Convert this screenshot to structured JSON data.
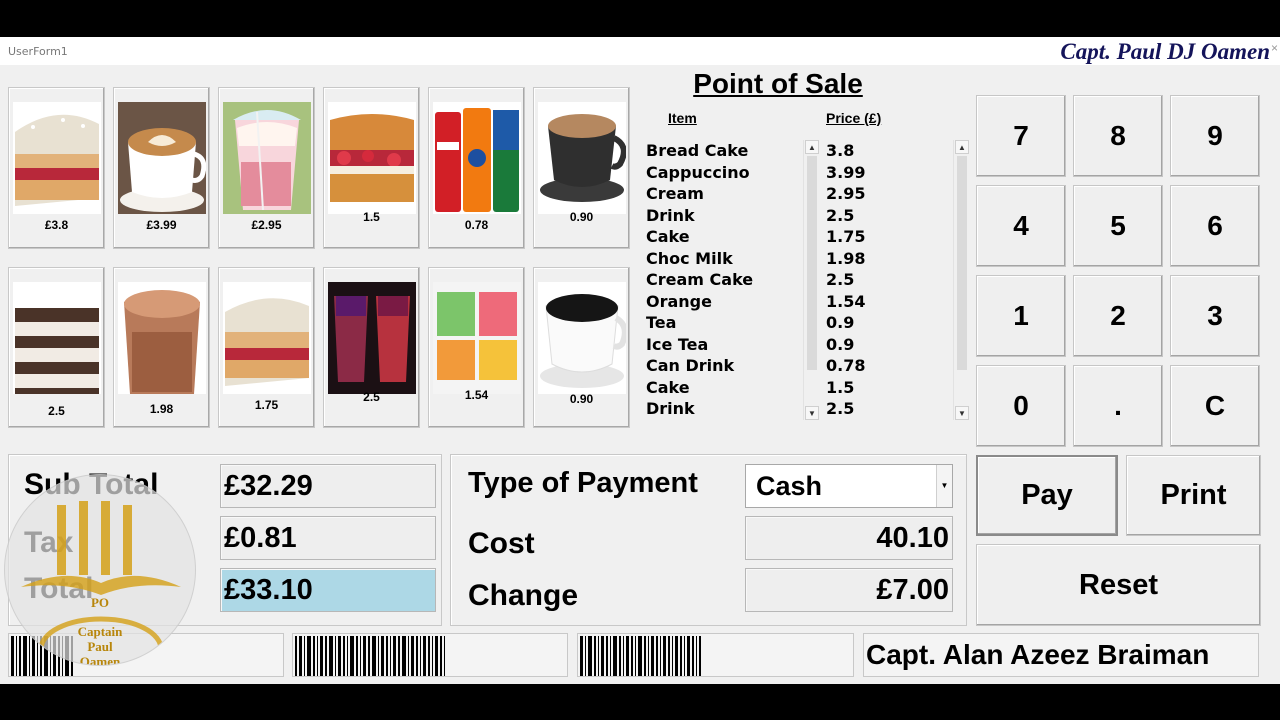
{
  "window": {
    "title": "UserForm1",
    "author": "Capt. Paul DJ Oamen",
    "close_icon": "×"
  },
  "tiles": [
    {
      "name": "bread-cake-tile",
      "price": "£3.8"
    },
    {
      "name": "cappuccino-tile",
      "price": "£3.99"
    },
    {
      "name": "cream-tile",
      "price": "£2.95"
    },
    {
      "name": "sponge-cake-tile",
      "price": "1.5"
    },
    {
      "name": "can-drink-tile",
      "price": "0.78"
    },
    {
      "name": "tea-tile",
      "price": "0.90"
    },
    {
      "name": "layer-cake-tile",
      "price": "2.5"
    },
    {
      "name": "choc-milk-tile",
      "price": "1.98"
    },
    {
      "name": "cake-tile",
      "price": "1.75"
    },
    {
      "name": "drink-tile",
      "price": "2.5"
    },
    {
      "name": "orange-tile",
      "price": "1.54"
    },
    {
      "name": "ice-tea-tile",
      "price": "0.90"
    }
  ],
  "pos_title": "Point of Sale",
  "list": {
    "item_header": "Item",
    "price_header": "Price (£)",
    "items": [
      "Bread Cake",
      "Cappuccino",
      "Cream",
      "Drink",
      "Cake",
      "Choc Milk",
      "Cream Cake",
      "Orange",
      "Tea",
      "Ice Tea",
      "Can Drink",
      "Cake",
      "Drink"
    ],
    "prices": [
      "3.8",
      "3.99",
      "2.95",
      "2.5",
      "1.75",
      "1.98",
      "2.5",
      "1.54",
      "0.9",
      "0.9",
      "0.78",
      "1.5",
      "2.5"
    ],
    "scroll_up_icon": "▲",
    "scroll_down_icon": "▼"
  },
  "keypad": [
    "7",
    "8",
    "9",
    "4",
    "5",
    "6",
    "1",
    "2",
    "3",
    "0",
    ".",
    "C"
  ],
  "totals": {
    "subtotal_label": "Sub Total",
    "subtotal_value": "£32.29",
    "tax_label": "Tax",
    "tax_value": "£0.81",
    "total_label": "Total",
    "total_value": "£33.10",
    "total_color": "#add8e6"
  },
  "payment": {
    "type_label": "Type of Payment",
    "type_value": "Cash",
    "dropdown_icon": "▼",
    "cost_label": "Cost",
    "cost_value": "40.10",
    "change_label": "Change",
    "change_value": "£7.00"
  },
  "actions": {
    "pay_label": "Pay",
    "print_label": "Print",
    "reset_label": "Reset"
  },
  "footer": {
    "name": "Capt. Alan Azeez Braiman"
  },
  "logo": {
    "initials": "PO",
    "line1": "Captain",
    "line2": "Paul",
    "line3": "Oamen"
  }
}
